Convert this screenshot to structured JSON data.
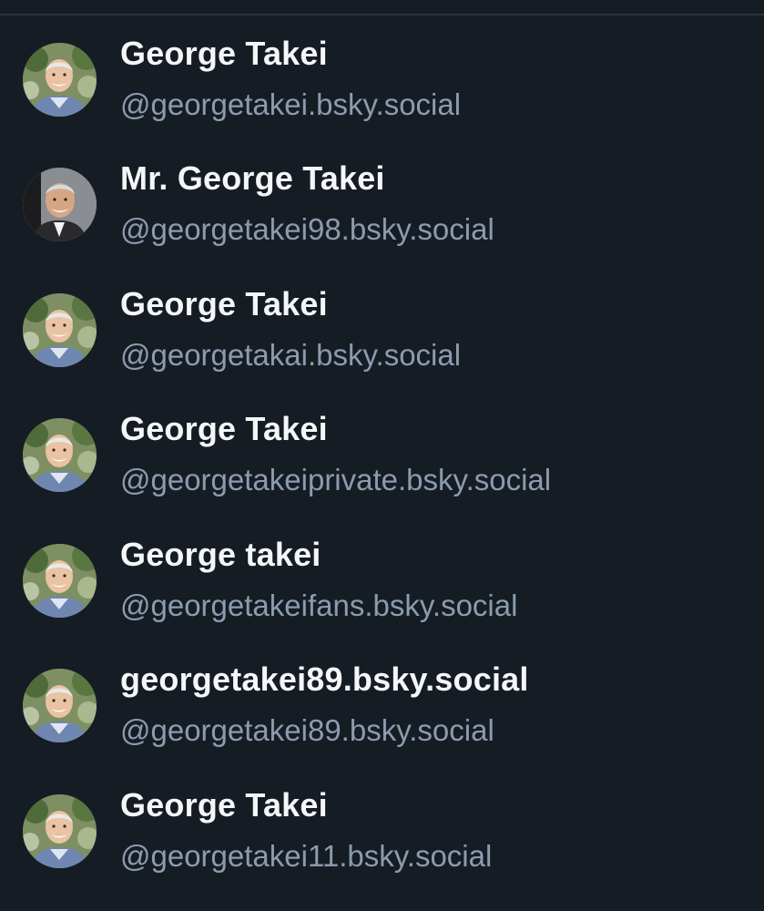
{
  "results": [
    {
      "display_name": "George Takei",
      "handle": "@georgetakei.bsky.social",
      "avatar_style": "outdoor"
    },
    {
      "display_name": "Mr. George Takei",
      "handle": "@georgetakei98.bsky.social",
      "avatar_style": "suit"
    },
    {
      "display_name": "George Takei",
      "handle": "@georgetakai.bsky.social",
      "avatar_style": "outdoor"
    },
    {
      "display_name": "George Takei",
      "handle": "@georgetakeiprivate.bsky.social",
      "avatar_style": "outdoor"
    },
    {
      "display_name": "George takei",
      "handle": "@georgetakeifans.bsky.social",
      "avatar_style": "outdoor"
    },
    {
      "display_name": "georgetakei89.bsky.social",
      "handle": "@georgetakei89.bsky.social",
      "avatar_style": "outdoor"
    },
    {
      "display_name": "George Takei",
      "handle": "@georgetakei11.bsky.social",
      "avatar_style": "outdoor"
    }
  ],
  "colors": {
    "background": "#161c24",
    "display_name": "#f4f6f8",
    "handle": "#8c9bad",
    "divider": "#2b3541"
  }
}
